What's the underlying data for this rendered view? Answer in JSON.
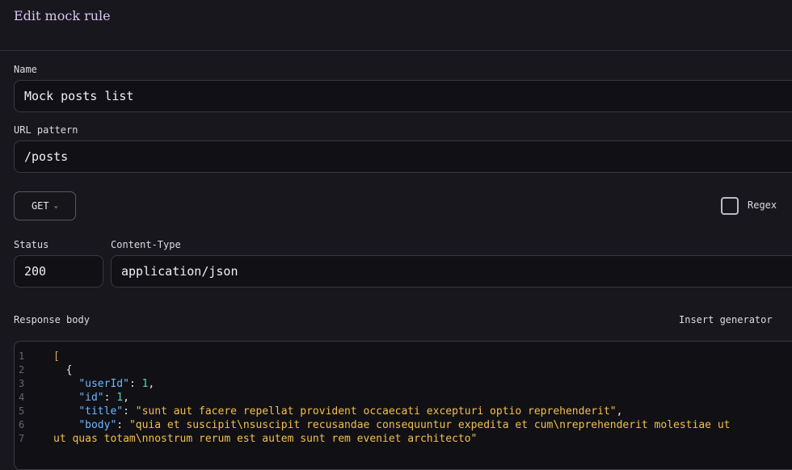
{
  "header": {
    "title": "Edit mock rule"
  },
  "form": {
    "name_label": "Name",
    "name_value": "Mock posts list",
    "url_label": "URL pattern",
    "url_value": "/posts",
    "method": "GET",
    "regex_label": "Regex",
    "regex_checked": false,
    "status_label": "Status",
    "status_value": "200",
    "content_type_label": "Content-Type",
    "content_type_value": "application/json",
    "response_body_label": "Response body",
    "insert_generator_label": "Insert generator"
  },
  "editor": {
    "line_numbers": [
      "1",
      "2",
      "3",
      "4",
      "5",
      "6",
      "7"
    ],
    "line1": "[",
    "line2": "  {",
    "line3_key": "\"userId\"",
    "line3_val": "1",
    "line4_key": "\"id\"",
    "line4_val": "1",
    "line5_key": "\"title\"",
    "line5_val": "\"sunt aut facere repellat provident occaecati excepturi optio reprehenderit\"",
    "line6_key": "\"body\"",
    "line6_val": "\"quia et suscipit\\nsuscipit recusandae consequuntur expedita et cum\\nreprehenderit molestiae ut",
    "line7_text": "ut quas totam\\nnostrum rerum est autem sunt rem eveniet architecto\""
  }
}
